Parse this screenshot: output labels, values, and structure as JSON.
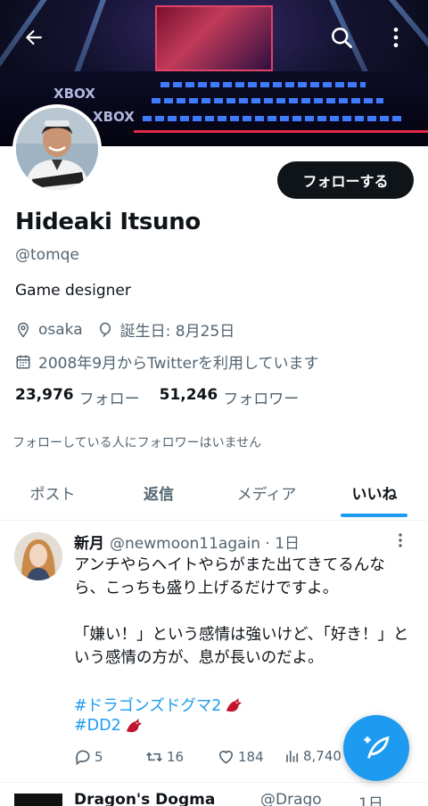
{
  "header": {
    "banner_text": "XBOX"
  },
  "profile": {
    "follow_label": "フォローする",
    "name": "Hideaki Itsuno",
    "handle": "@tomqe",
    "bio": "Game designer",
    "location": "osaka",
    "birthday": "誕生日: 8月25日",
    "joined": "2008年9月からTwitterを利用しています",
    "following_count": "23,976",
    "following_label": "フォロー",
    "followers_count": "51,246",
    "followers_label": "フォロワー",
    "no_mutuals": "フォローしている人にフォロワーはいません"
  },
  "tabs": [
    {
      "label": "ポスト"
    },
    {
      "label": "返信"
    },
    {
      "label": "メディア"
    },
    {
      "label": "いいね"
    }
  ],
  "post": {
    "display_name": "新月",
    "handle_time": "@newmoon11again · 1日",
    "text": "アンチやらヘイトやらがまた出てきてるんなら、こっちも盛り上げるだけですよ。\n\n「嫌い！」という感情は強いけど、「好き！」という感情の方が、息が長いのだよ。",
    "hashtag1": "#ドラゴンズドグマ2",
    "hashtag2": "#DD2",
    "replies": "5",
    "reposts": "16",
    "likes": "184",
    "views": "8,740"
  },
  "next_post": {
    "display_name": "Dragon's Dogma",
    "handle": "@Drago",
    "time": "1日"
  },
  "colors": {
    "accent": "#1d9bf0",
    "text": "#0f1419",
    "secondary": "#536471"
  }
}
